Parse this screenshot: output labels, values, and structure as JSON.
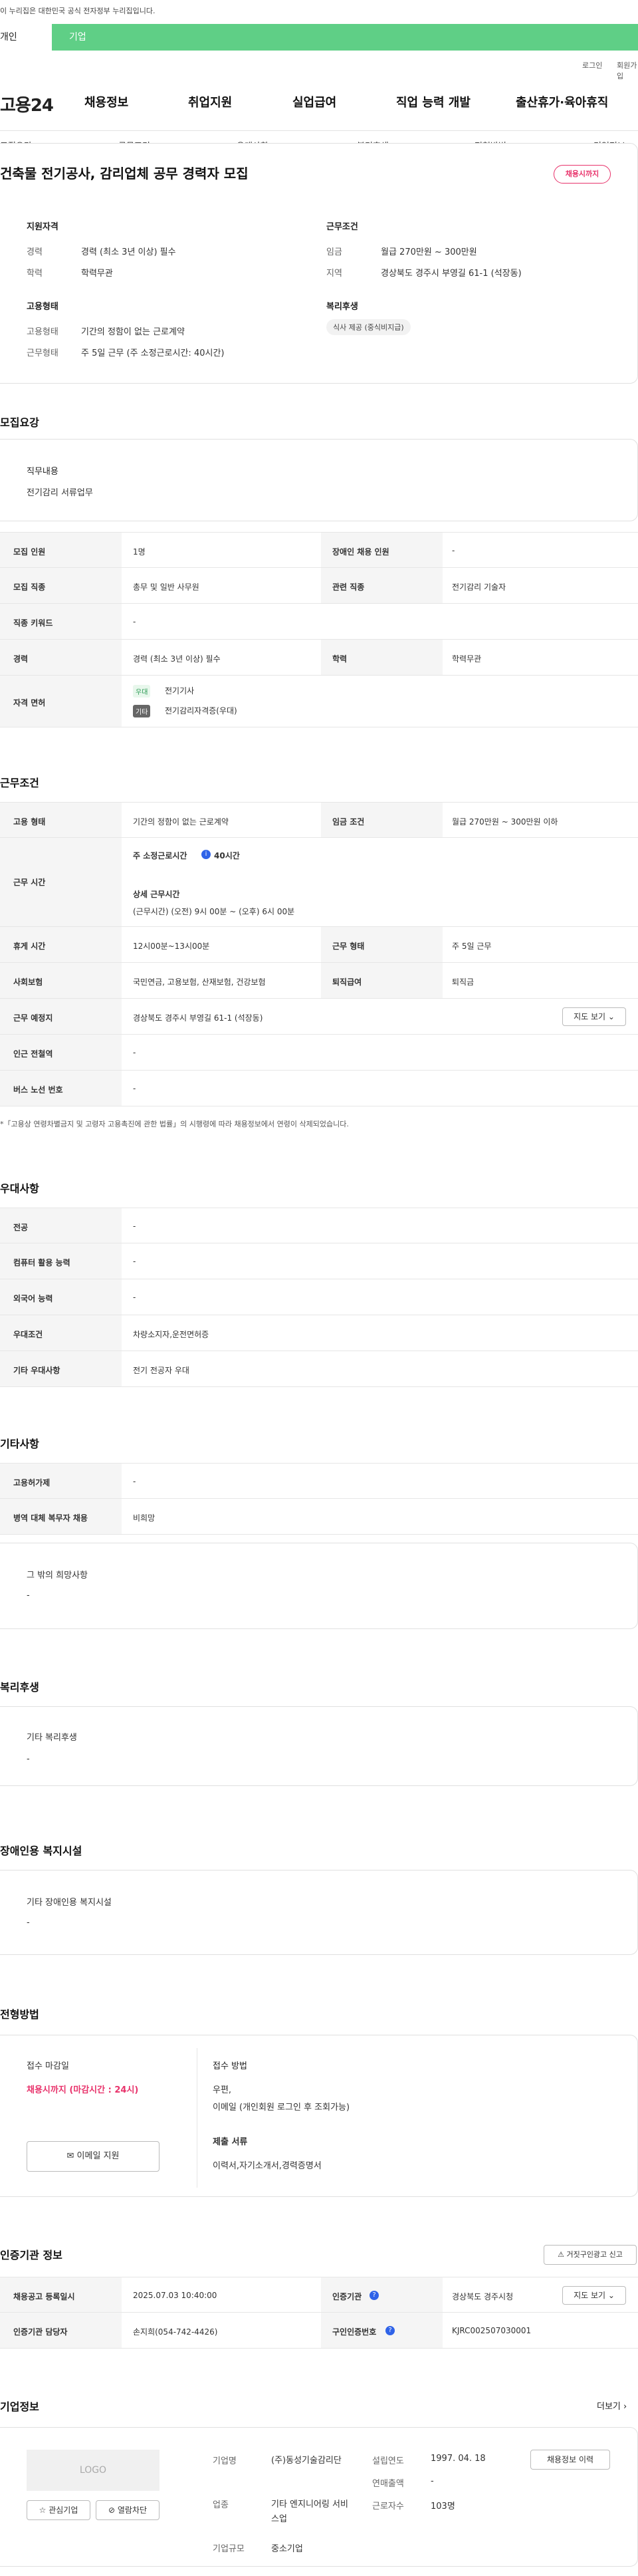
{
  "gov_notice": "이 누리집은 대한민국 공식 전자정부 누리집입니다.",
  "top_tabs": [
    "개인",
    "기업"
  ],
  "util": {
    "login": "로그인",
    "join": "회원가입"
  },
  "logo": "고용24",
  "gnb": [
    "채용정보",
    "취업지원",
    "실업급여",
    "직업 능력 개발",
    "출산휴가·육아휴직"
  ],
  "subnav": [
    "모집요강",
    "근무조건",
    "우대사항",
    "복리후생",
    "전형방법",
    "기업정보"
  ],
  "job": {
    "title": "건축물 전기공사, 감리업체 공무 경력자 모집",
    "badge": "채용시까지",
    "qual_title": "지원자격",
    "qual": [
      {
        "label": "경력",
        "value": "경력 (최소 3년 이상) 필수"
      },
      {
        "label": "학력",
        "value": "학력무관"
      }
    ],
    "cond_title": "근무조건",
    "cond": [
      {
        "label": "임금",
        "value": "월급 270만원 ~ 300만원"
      },
      {
        "label": "지역",
        "value": "경상북도 경주시 부영길 61-1 (석장동)"
      }
    ],
    "emp_title": "고용형태",
    "emp": [
      {
        "label": "고용형태",
        "value": "기간의 정함이 없는 근로계약"
      },
      {
        "label": "근무형태",
        "value": "주 5일 근무 (주 소정근로시간: 40시간)"
      }
    ],
    "welfare_title": "복리후생",
    "welfare_chip": "식사 제공 (중식비지급)"
  },
  "recruit": {
    "title": "모집요강",
    "duty_label": "직무내용",
    "duty_value": "전기감리 서류업무",
    "rows": [
      {
        "th1": "모집 인원",
        "td1": "1명",
        "th2": "장애인 채용 인원",
        "td2": "-"
      },
      {
        "th1": "모집 직종",
        "td1": "총무 및 일반 사무원",
        "th2": "관련 직종",
        "td2": "전기감리 기술자"
      },
      {
        "th1": "직종 키워드",
        "td1": "-"
      },
      {
        "th1": "경력",
        "td1": "경력 (최소 3년 이상) 필수",
        "th2": "학력",
        "td2": "학력무관"
      }
    ],
    "license_label": "자격 면허",
    "licenses": [
      {
        "chip": "우대",
        "name": "전기기사"
      },
      {
        "chip": "기타",
        "name": "전기감리자격증(우대)"
      }
    ]
  },
  "work": {
    "title": "근무조건",
    "emp_type_label": "고용 형태",
    "emp_type": "기간의 정함이 없는 근로계약",
    "wage_label": "임금 조건",
    "wage": "월급 270만원 ~ 300만원 이하",
    "hours_label": "근무 시간",
    "hours_main": "주 소정근로시간",
    "hours_main_val": "40시간",
    "hours_detail_title": "상세 근무시간",
    "hours_detail": "(근무시간) (오전) 9시 00분 ~ (오후) 6시 00분",
    "rest_label": "휴게 시간",
    "rest": "12시00분~13시00분",
    "form_label": "근무 형태",
    "form": "주 5일 근무",
    "ins_label": "사회보험",
    "ins": "국민연금, 고용보험, 산재보험, 건강보험",
    "retire_label": "퇴직급여",
    "retire": "퇴직금",
    "place_label": "근무 예정지",
    "place": "경상북도 경주시 부영길 61-1 (석장동)",
    "map_btn": "지도 보기",
    "subway_label": "인근 전철역",
    "subway": "-",
    "bus_label": "버스 노선 번호",
    "bus": "-",
    "note": "*「고용상 연령차별금지 및 고령자 고용촉진에 관한 법률」의 시행령에 따라 채용정보에서 연령이 삭제되었습니다."
  },
  "pref": {
    "title": "우대사항",
    "rows": [
      {
        "th": "전공",
        "td": "-"
      },
      {
        "th": "컴퓨터 활용 능력",
        "td": "-"
      },
      {
        "th": "외국어 능력",
        "td": "-"
      },
      {
        "th": "우대조건",
        "td": "차량소지자,운전면허증"
      },
      {
        "th": "기타 우대사항",
        "td": "전기 전공자 우대"
      }
    ]
  },
  "etc": {
    "title": "기타사항",
    "rows": [
      {
        "th": "고용허가제",
        "td": "-"
      },
      {
        "th": "병역 대체 복무자 채용",
        "td": "비희망"
      }
    ],
    "other_label": "그 밖의 희망사항",
    "other_value": "-"
  },
  "welfare": {
    "title": "복리후생",
    "label": "기타 복리후생",
    "value": "-"
  },
  "disabled": {
    "title": "장애인용 복지시설",
    "label": "기타 장애인용 복지시설",
    "value": "-"
  },
  "process": {
    "title": "전형방법",
    "deadline_label": "접수 마감일",
    "deadline_value": "채용시까지 (마감시간 : 24시)",
    "apply_btn": "이메일 지원",
    "method_label": "접수 방법",
    "method_lines": [
      "우편,",
      "이메일 (개인회원 로그인 후 조회가능)"
    ],
    "docs_label": "제출 서류",
    "docs_value": "이력서,자기소개서,경력증명서"
  },
  "cert": {
    "title": "인증기관 정보",
    "report_btn": "거짓구인광고 신고",
    "rows": [
      {
        "th1": "채용공고 등록일시",
        "td1": "2025.07.03 10:40:00",
        "th2": "인증기관",
        "td2": "경상북도 경주시청"
      },
      {
        "th1": "인증기관 담당자",
        "td1": "손지희(054-742-4426)",
        "th2": "구인인증번호",
        "td2": "KJRC002507030001"
      }
    ],
    "map_btn": "지도 보기"
  },
  "company": {
    "title": "기업정보",
    "more": "더보기",
    "logo": "LOGO",
    "fav_btn": "관심기업",
    "block_btn": "열람차단",
    "fields": [
      {
        "label": "기업명",
        "value": "(주)동성기술감리단"
      },
      {
        "label": "업종",
        "value": "기타 엔지니어링 서비스업"
      },
      {
        "label": "기업규모",
        "value": "중소기업"
      }
    ],
    "fields2": [
      {
        "label": "설립연도",
        "value": "1997. 04. 18"
      },
      {
        "label": "연매출액",
        "value": "-"
      },
      {
        "label": "근로자수",
        "value": "103명"
      }
    ],
    "history_btn": "채용정보 이력"
  }
}
